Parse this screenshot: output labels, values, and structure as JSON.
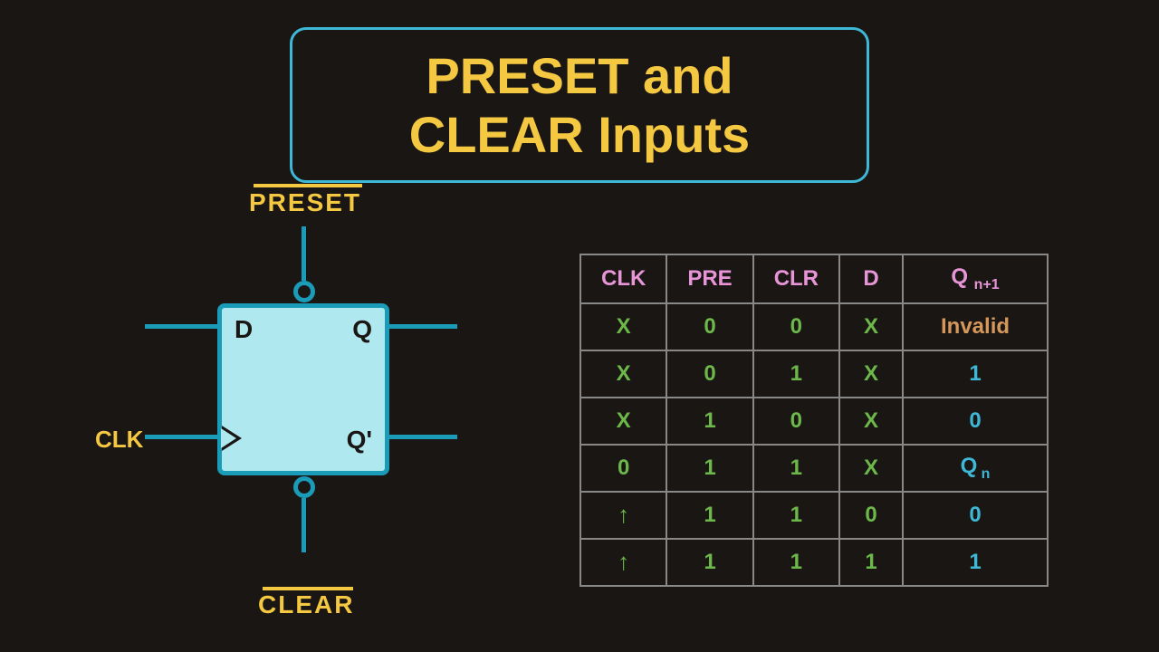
{
  "title": "PRESET and CLEAR Inputs",
  "diagram": {
    "preset_label": "PRESET",
    "clear_label": "CLEAR",
    "clk_label": "CLK",
    "d_label": "D",
    "q_label": "Q",
    "qbar_label": "Q'"
  },
  "table": {
    "headers": {
      "clk": "CLK",
      "pre": "PRE",
      "clr": "CLR",
      "d": "D",
      "q": "Q",
      "q_sub": "n+1"
    },
    "rows": [
      {
        "clk": "X",
        "pre": "0",
        "clr": "0",
        "d": "X",
        "q": "Invalid",
        "q_class": "c-orange"
      },
      {
        "clk": "X",
        "pre": "0",
        "clr": "1",
        "d": "X",
        "q": "1",
        "q_class": "c-cyan"
      },
      {
        "clk": "X",
        "pre": "1",
        "clr": "0",
        "d": "X",
        "q": "0",
        "q_class": "c-cyan"
      },
      {
        "clk": "0",
        "pre": "1",
        "clr": "1",
        "d": "X",
        "q": "Q",
        "q_sub": "n",
        "q_class": "c-cyan"
      },
      {
        "clk": "↑",
        "pre": "1",
        "clr": "1",
        "d": "0",
        "q": "0",
        "q_class": "c-cyan"
      },
      {
        "clk": "↑",
        "pre": "1",
        "clr": "1",
        "d": "1",
        "q": "1",
        "q_class": "c-cyan"
      }
    ]
  }
}
